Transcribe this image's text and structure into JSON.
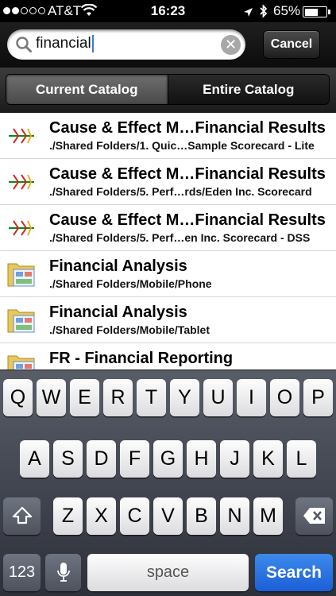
{
  "status_bar": {
    "carrier": "AT&T",
    "time": "16:23",
    "battery_percent": "65%",
    "battery_level": 0.65,
    "signal_bars": 2
  },
  "search": {
    "query": "financial",
    "cancel_label": "Cancel"
  },
  "segments": [
    {
      "label": "Current Catalog",
      "selected": true
    },
    {
      "label": "Entire Catalog",
      "selected": false
    }
  ],
  "results": [
    {
      "icon": "cause-effect-diagram-icon",
      "title": "Cause & Effect M…Financial Results",
      "path": "./Shared Folders/1. Quic…Sample Scorecard - Lite"
    },
    {
      "icon": "cause-effect-diagram-icon",
      "title": "Cause & Effect M…Financial Results",
      "path": "./Shared Folders/5. Perf…rds/Eden Inc. Scorecard"
    },
    {
      "icon": "cause-effect-diagram-icon",
      "title": "Cause & Effect M…Financial Results",
      "path": "./Shared Folders/5. Perf…en Inc. Scorecard - DSS"
    },
    {
      "icon": "dashboard-folder-icon",
      "title": "Financial Analysis",
      "path": "./Shared Folders/Mobile/Phone"
    },
    {
      "icon": "dashboard-folder-icon",
      "title": "Financial Analysis",
      "path": "./Shared Folders/Mobile/Tablet"
    },
    {
      "icon": "dashboard-folder-icon",
      "title": "FR - Financial Reporting",
      "path": ""
    }
  ],
  "keyboard": {
    "row1": [
      "Q",
      "W",
      "E",
      "R",
      "T",
      "Y",
      "U",
      "I",
      "O",
      "P"
    ],
    "row2": [
      "A",
      "S",
      "D",
      "F",
      "G",
      "H",
      "J",
      "K",
      "L"
    ],
    "row3": [
      "Z",
      "X",
      "C",
      "V",
      "B",
      "N",
      "M"
    ],
    "numbers_label": "123",
    "space_label": "space",
    "search_label": "Search"
  }
}
